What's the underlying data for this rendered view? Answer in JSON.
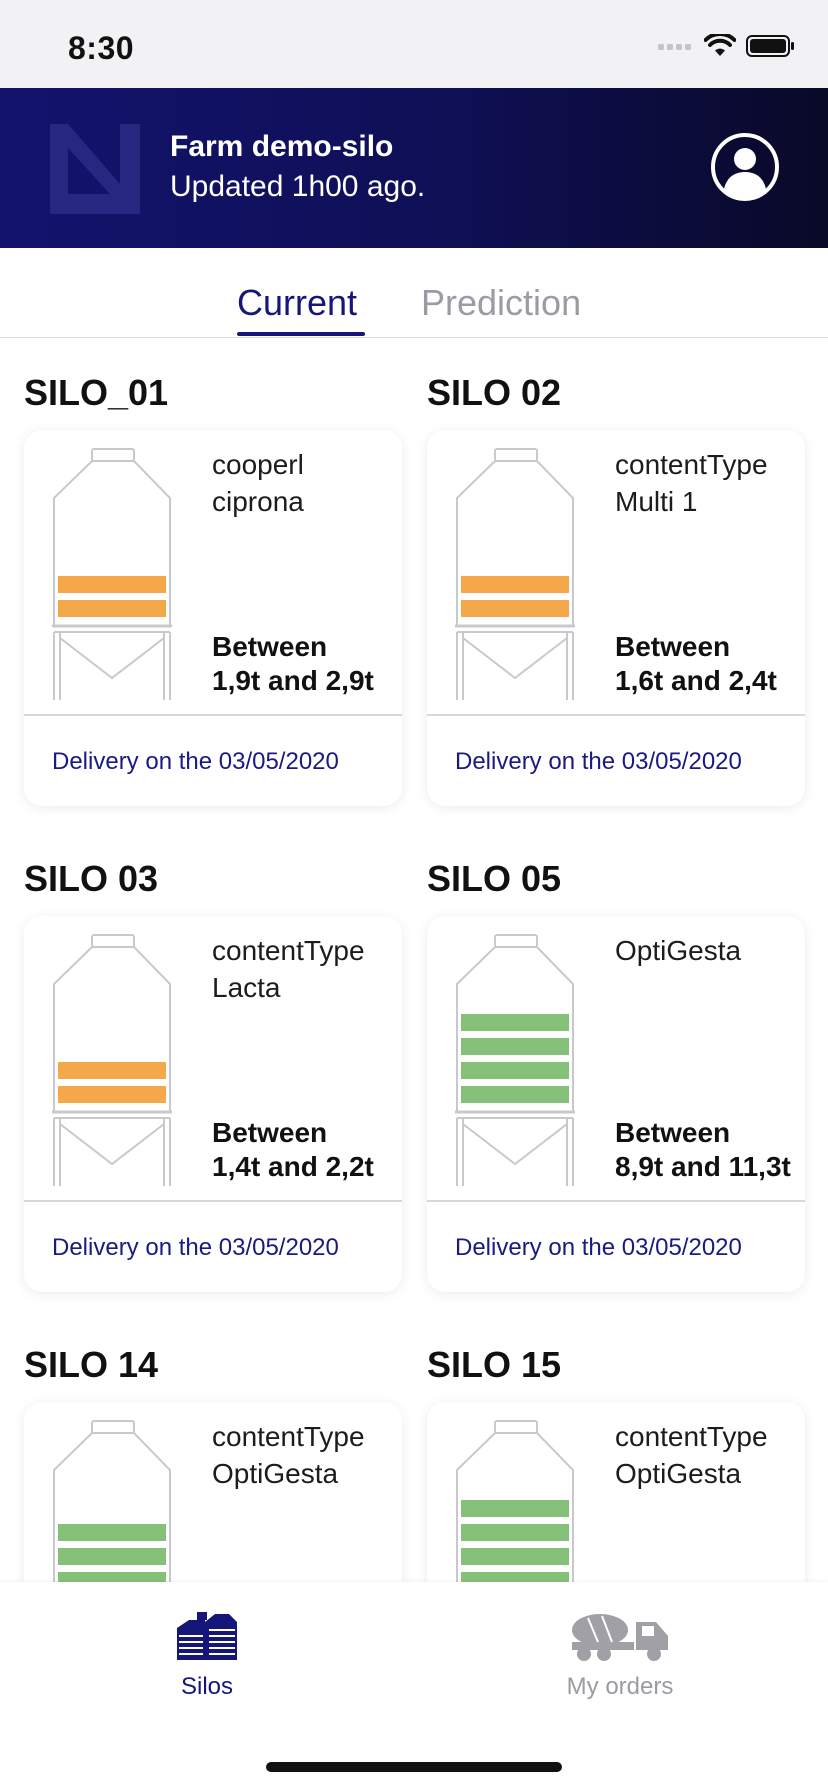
{
  "status_bar": {
    "time": "8:30"
  },
  "header": {
    "farm_title": "Farm demo-silo",
    "updated": "Updated 1h00 ago."
  },
  "tabs": [
    {
      "label": "Current",
      "active": true
    },
    {
      "label": "Prediction",
      "active": false
    }
  ],
  "silos": [
    {
      "name": "SILO_01",
      "content": "cooperl\nciprona",
      "range_label": "Between",
      "range": "1,9t and 2,9t",
      "delivery": "Delivery on the 03/05/2020",
      "fill_color": "#f4a84a",
      "fill_bars": 2
    },
    {
      "name": "SILO 02",
      "content": "contentType\nMulti 1",
      "range_label": "Between",
      "range": "1,6t and 2,4t",
      "delivery": "Delivery on the 03/05/2020",
      "fill_color": "#f4a84a",
      "fill_bars": 2
    },
    {
      "name": "SILO 03",
      "content": "contentType\nLacta",
      "range_label": "Between",
      "range": "1,4t and 2,2t",
      "delivery": "Delivery on the 03/05/2020",
      "fill_color": "#f4a84a",
      "fill_bars": 2
    },
    {
      "name": "SILO 05",
      "content": "OptiGesta",
      "range_label": "Between",
      "range": "8,9t and 11,3t",
      "delivery": "Delivery on the 03/05/2020",
      "fill_color": "#86c17a",
      "fill_bars": 4
    },
    {
      "name": "SILO 14",
      "content": "contentType\nOptiGesta",
      "range_label": "",
      "range": "",
      "delivery": "",
      "fill_color": "#86c17a",
      "fill_bars": 3
    },
    {
      "name": "SILO 15",
      "content": "contentType\nOptiGesta",
      "range_label": "",
      "range": "",
      "delivery": "",
      "fill_color": "#86c17a",
      "fill_bars": 4
    }
  ],
  "bottom_nav": [
    {
      "label": "Silos",
      "icon": "silos-icon",
      "active": true
    },
    {
      "label": "My orders",
      "icon": "truck-icon",
      "active": false
    }
  ],
  "colors": {
    "primary": "#16167a",
    "orange_fill": "#f4a84a",
    "green_fill": "#86c17a",
    "inactive": "#9b9ba3"
  }
}
